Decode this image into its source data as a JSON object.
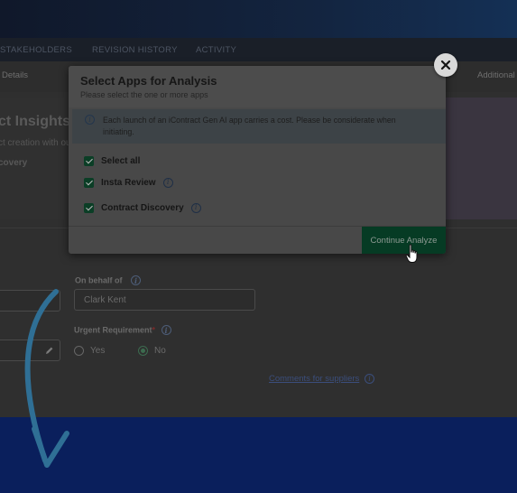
{
  "nav": {
    "tabs": [
      {
        "label": "STAKEHOLDERS"
      },
      {
        "label": "REVISION HISTORY"
      },
      {
        "label": "ACTIVITY"
      }
    ]
  },
  "subnav": {
    "left": "Details",
    "right": "Additional"
  },
  "hero": {
    "title": "ct Insights Su",
    "subtitle": "ct creation with ou",
    "item": "covery"
  },
  "form": {
    "on_behalf_label": "On behalf of",
    "on_behalf_value": "Clark Kent",
    "urgent_label": "Urgent Requirement",
    "urgent_required_mark": "*",
    "yes_label": "Yes",
    "no_label": "No",
    "comments_link": "Comments for suppliers"
  },
  "modal": {
    "title": "Select Apps for Analysis",
    "subtitle": "Please select the one or more apps",
    "notice": "Each launch of an iContract Gen AI app carries a cost. Please be considerate when initiating.",
    "options": [
      {
        "label": "Select all",
        "checked": true
      },
      {
        "label": "Insta Review",
        "checked": true
      },
      {
        "label": "Contract Discovery",
        "checked": true
      }
    ],
    "continue_label": "Continue Analyze",
    "close_icon": "close-icon"
  },
  "colors": {
    "accent_green": "#063b24",
    "bottom_band": "#0a1f5c",
    "arrow": "#2f6f95"
  }
}
